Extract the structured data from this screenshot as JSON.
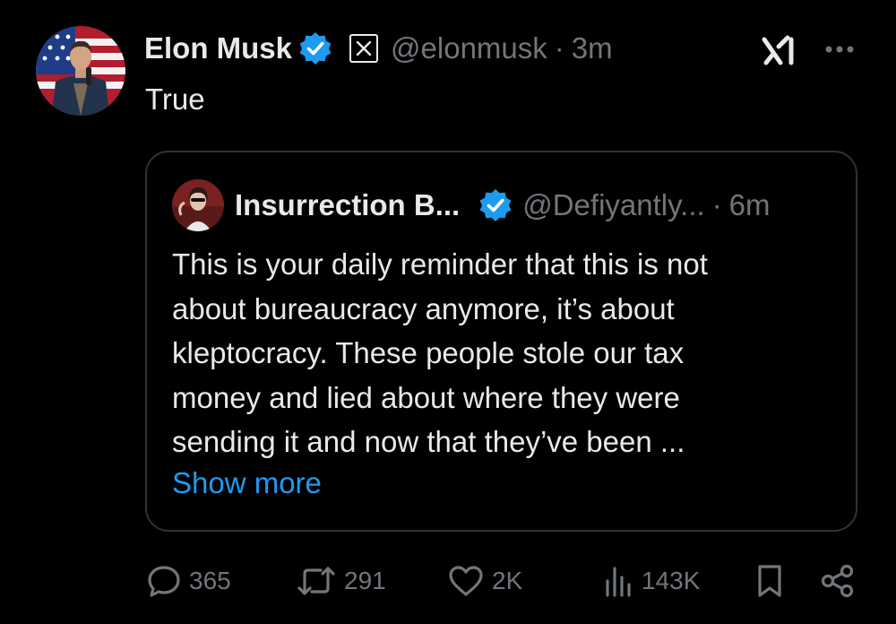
{
  "tweet": {
    "author_name": "Elon Musk",
    "handle": "@elonmusk",
    "separator": "·",
    "time": "3m",
    "text": "True"
  },
  "quote": {
    "author_name": "Insurrection B...",
    "handle": "@Defiyantly...",
    "separator": "·",
    "time": "6m",
    "text": "This is your daily reminder that this is not\nabout bureaucracy anymore, it’s about\nkleptocracy. These people stole our tax\nmoney and lied about where they were\nsending it and now that they’ve been ...",
    "show_more": "Show more"
  },
  "actions": {
    "replies": "365",
    "reposts": "291",
    "likes": "2K",
    "views": "143K"
  },
  "icons": {
    "verified": "verified-badge-icon",
    "x_logo": "x-logo-icon",
    "grok": "grok-icon",
    "more": "more-options-icon",
    "reply": "reply-icon",
    "repost": "repost-icon",
    "like": "heart-icon",
    "views": "views-icon",
    "bookmark": "bookmark-icon",
    "share": "share-icon"
  },
  "colors": {
    "background": "#000000",
    "text": "#e7e9ea",
    "muted": "#71767b",
    "accent": "#1d9bf0",
    "border": "#2f3336"
  }
}
